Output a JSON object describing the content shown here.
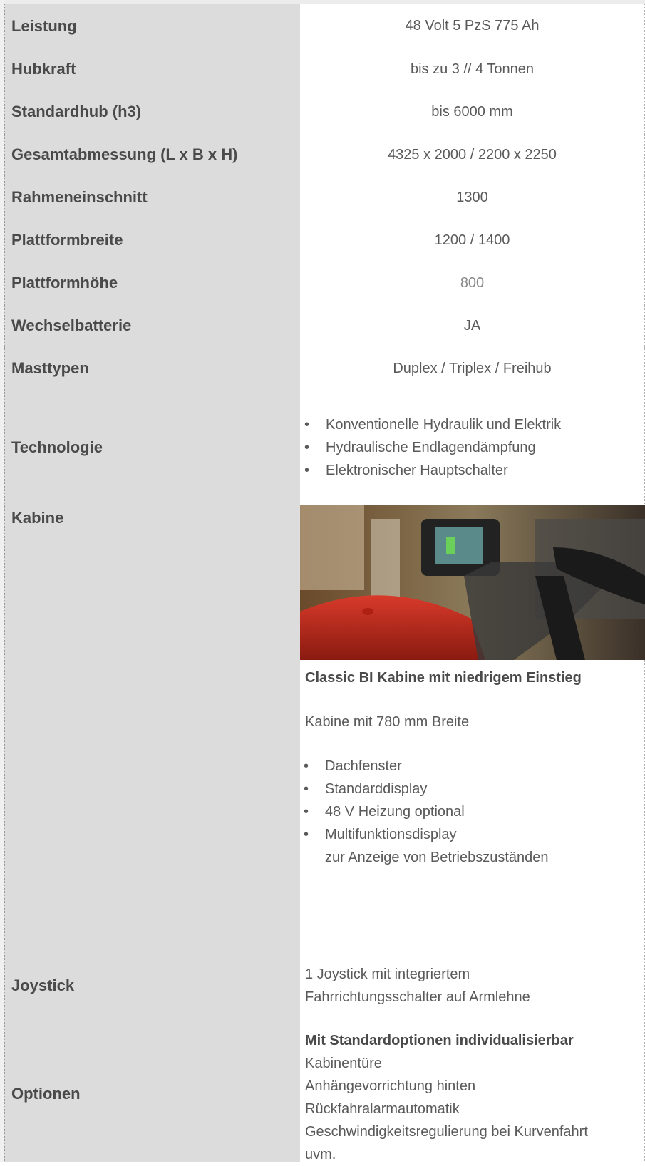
{
  "rows": [
    {
      "label": "Leistung",
      "value": "48 Volt  5 PzS 775 Ah"
    },
    {
      "label": "Hubkraft",
      "value": "bis zu 3 // 4 Tonnen"
    },
    {
      "label": "Standardhub (h3)",
      "value": "bis 6000 mm"
    },
    {
      "label": "Gesamtabmessung (L x B x H)",
      "value": "4325 x 2000 / 2200 x 2250"
    },
    {
      "label": "Rahmeneinschnitt",
      "value": "1300"
    },
    {
      "label": "Plattformbreite",
      "value": "1200 / 1400"
    },
    {
      "label": "Plattformhöhe",
      "value": "800"
    },
    {
      "label": "Wechselbatterie",
      "value": "JA"
    },
    {
      "label": "Masttypen",
      "value": "Duplex / Triplex / Freihub"
    }
  ],
  "technologie": {
    "label": "Technologie",
    "items": [
      "Konventionelle Hydraulik und Elektrik",
      "Hydraulische Endlagendämpfung",
      "Elektronischer Hauptschalter"
    ]
  },
  "kabine": {
    "label": "Kabine",
    "title": "Classic BI Kabine mit niedrigem Einstieg",
    "subtitle": "Kabine mit 780 mm Breite",
    "items": [
      "Dachfenster",
      "Standarddisplay",
      "48 V Heizung optional",
      "Multifunktionsdisplay"
    ],
    "item_continuation": "zur Anzeige von Betriebszuständen"
  },
  "joystick": {
    "label": "Joystick",
    "line1": "1 Joystick mit integriertem",
    "line2": "Fahrrichtungsschalter auf Armlehne"
  },
  "optionen": {
    "label": "Optionen",
    "title": "Mit Standardoptionen individualisierbar",
    "lines": [
      "Kabinentüre",
      "Anhängevorrichtung hinten",
      "Rückfahralarmautomatik",
      "Geschwindigkeitsregulierung bei Kurvenfahrt",
      "uvm."
    ]
  }
}
